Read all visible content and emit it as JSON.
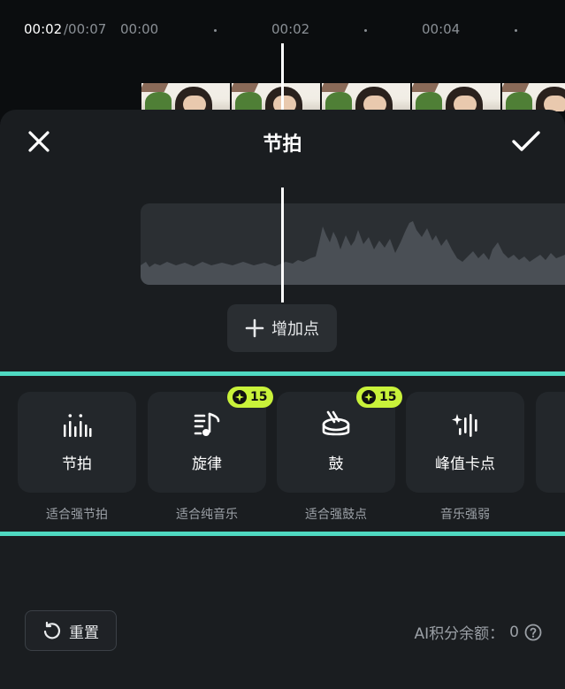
{
  "timeline": {
    "current_time": "00:02",
    "total_time": "/00:07",
    "ticks": [
      "00:00",
      "00:02",
      "00:04"
    ]
  },
  "panel": {
    "title": "节拍"
  },
  "add_point": {
    "label": "增加点"
  },
  "modes": [
    {
      "label": "节拍",
      "desc": "适合强节拍",
      "icon": "beat-bars-icon"
    },
    {
      "label": "旋律",
      "desc": "适合纯音乐",
      "icon": "melody-notes-icon",
      "cost": "15"
    },
    {
      "label": "鼓",
      "desc": "适合强鼓点",
      "icon": "drum-icon",
      "cost": "15"
    },
    {
      "label": "峰值卡点",
      "desc": "音乐强弱",
      "icon": "peak-sparkle-icon"
    }
  ],
  "footer": {
    "reset_label": "重置",
    "ai_balance_label": "AI积分余额：",
    "ai_balance_value": "0"
  },
  "colors": {
    "accent": "#4fd9c1",
    "badge": "#c9f23a",
    "panel_bg": "#1a1d20",
    "card_bg": "#23272b"
  }
}
